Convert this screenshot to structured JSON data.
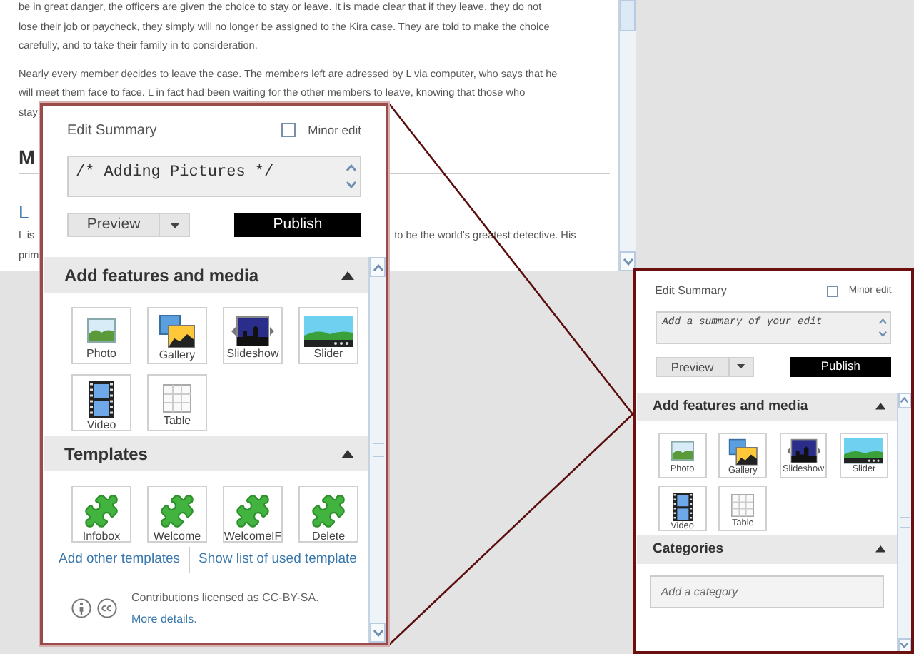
{
  "article": {
    "blocks": [
      {
        "kind": "paragraph",
        "lines": [
          {
            "text": "be in great danger, the officers are given the choice to stay or leave. It is made clear that if they leave, they do not"
          },
          {
            "text": "lose their job or paycheck, they simply will no longer be assigned to the Kira case. They are told to make the choice"
          },
          {
            "text": "carefully, and to take their family in to consideration."
          }
        ]
      },
      {
        "kind": "paragraph",
        "lines": [
          {
            "text": "Nearly every member decides to leave the case. The members left are adressed by L via computer, who says that he"
          },
          {
            "text": "will meet them face to face. L in fact had been waiting for the other members to leave, knowing that those who"
          },
          {
            "text": "stay"
          }
        ]
      },
      {
        "kind": "heading",
        "text": "M"
      },
      {
        "kind": "link",
        "text": "L"
      },
      {
        "kind": "paragraph",
        "lines": [
          {
            "text": "L is",
            "right": "to be the world's greatest detective. His"
          },
          {
            "text": "prim"
          }
        ]
      }
    ]
  },
  "zoomed_panel": {
    "summary_label": "Edit Summary",
    "minor_edit": {
      "label": "Minor edit",
      "checked": false
    },
    "summary": {
      "value": "/* Adding Pictures */"
    },
    "preview": "Preview",
    "publish": "Publish",
    "sections": [
      {
        "title": "Add features and media",
        "expanded": true,
        "kind": "tiles",
        "items": [
          {
            "label": "Photo",
            "kind": "photo"
          },
          {
            "label": "Gallery",
            "kind": "gallery"
          },
          {
            "label": "Slideshow",
            "kind": "slideshow"
          },
          {
            "label": "Slider",
            "kind": "slider"
          },
          {
            "label": "Video",
            "kind": "video"
          },
          {
            "label": "Table",
            "kind": "table"
          }
        ]
      },
      {
        "title": "Templates",
        "expanded": true,
        "kind": "tiles",
        "items": [
          {
            "label": "Infobox",
            "kind": "template"
          },
          {
            "label": "Welcome",
            "kind": "template"
          },
          {
            "label": "WelcomeIF",
            "kind": "template"
          },
          {
            "label": "Delete",
            "kind": "template"
          }
        ],
        "links": [
          "Add other templates",
          "Show list of used template"
        ]
      }
    ],
    "footer": {
      "text": "Contributions licensed as CC-BY-SA.",
      "link": "More details."
    }
  },
  "panel": {
    "summary_label": "Edit Summary",
    "minor_edit": {
      "label": "Minor edit",
      "checked": false
    },
    "summary": {
      "placeholder": "Add a summary of your edit"
    },
    "preview": "Preview",
    "publish": "Publish",
    "sections": [
      {
        "title": "Add features and media",
        "expanded": true,
        "kind": "tiles",
        "items": [
          {
            "label": "Photo",
            "kind": "photo"
          },
          {
            "label": "Gallery",
            "kind": "gallery"
          },
          {
            "label": "Slideshow",
            "kind": "slideshow"
          },
          {
            "label": "Slider",
            "kind": "slider"
          },
          {
            "label": "Video",
            "kind": "video"
          },
          {
            "label": "Table",
            "kind": "table"
          }
        ]
      },
      {
        "title": "Categories",
        "expanded": true,
        "kind": "input",
        "placeholder": "Add a category"
      }
    ]
  }
}
